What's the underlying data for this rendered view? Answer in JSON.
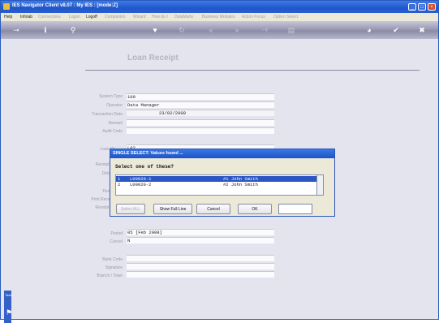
{
  "window": {
    "title": "IES Navigator Client v8.07 : My IES :     [mode:Z]",
    "controls": {
      "minimize": "_",
      "maximize": "□",
      "close": "×"
    }
  },
  "menu": {
    "items": [
      {
        "label": "Help",
        "enabled": true
      },
      {
        "label": "Infolab",
        "enabled": true
      },
      {
        "label": "Connections",
        "enabled": false
      },
      {
        "label": "Logon",
        "enabled": false
      },
      {
        "label": "Logoff",
        "enabled": true
      },
      {
        "label": "Companion",
        "enabled": false
      },
      {
        "label": "Wizard",
        "enabled": false
      },
      {
        "label": "How do I",
        "enabled": false
      },
      {
        "label": "DataMarts",
        "enabled": false
      },
      {
        "label": "Business Modules",
        "enabled": false
      },
      {
        "label": "Action Focus",
        "enabled": false
      },
      {
        "label": "Option Select",
        "enabled": false
      }
    ]
  },
  "toolbar": {
    "icons": [
      "key-icon",
      "info-icon",
      "search-icon",
      "heart-icon",
      "refresh-icon",
      "rewind-icon",
      "fast-forward-icon",
      "split-icon",
      "document-icon",
      "globe-icon",
      "check-icon",
      "cancel-icon"
    ]
  },
  "form": {
    "title": "Loan Receipt",
    "fields": [
      {
        "label": "System Type",
        "value": "100"
      },
      {
        "label": "Operator",
        "value": "Data Manager"
      },
      {
        "label": "Transaction Date",
        "value": "23/02/2008"
      },
      {
        "label": "Remark",
        "value": ""
      },
      {
        "label": "Audit Code",
        "value": ""
      },
      {
        "label": "Loan ID",
        "value": "L0?"
      },
      {
        "label": "Receipt ID",
        "value": ""
      },
      {
        "label": "Details",
        "value": ""
      },
      {
        "label": "Period",
        "value": ""
      },
      {
        "label": "Print Receipt",
        "value": ""
      },
      {
        "label": "Receipt Nr",
        "value": ""
      },
      {
        "label": "Period",
        "value": "05  [Feb 2008]"
      },
      {
        "label": "Cancel",
        "value": "N"
      },
      {
        "label": "Bank Code",
        "value": ""
      },
      {
        "label": "Signature",
        "value": ""
      },
      {
        "label": "Branch / Town",
        "value": ""
      }
    ]
  },
  "side_tab": {
    "label": "Tasks"
  },
  "dialog": {
    "title": "SINGLE SELECT: Values found ...",
    "prompt": "Select one of these?",
    "rows": [
      {
        "num": "1",
        "code": "L00020-1",
        "name": "#1 John Smith",
        "selected": true
      },
      {
        "num": "2",
        "code": "L00020-2",
        "name": "#2 John Smith",
        "selected": false
      }
    ],
    "buttons": {
      "select_all": "Select ALL",
      "show_full_line": "Show Full Line",
      "cancel": "Cancel",
      "ok": "OK"
    },
    "input_value": ""
  },
  "colors": {
    "titlebar": "#1f56c9",
    "selection": "#2b56c4",
    "background": "#e4e4ee"
  }
}
